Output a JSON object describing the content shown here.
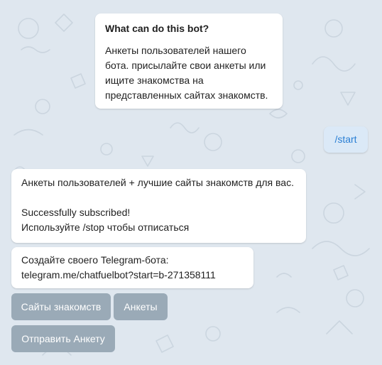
{
  "bot_info": {
    "title": "What can do this bot?",
    "description": "Анкеты пользователей нашего бота. присылайте свои анкеты или ищите знакомства на представленных сайтах знакомств."
  },
  "outgoing_message": {
    "text": "/start"
  },
  "messages": [
    {
      "lines": [
        "Анкеты пользователей + лучшие сайты знакомств для вас.",
        "",
        "Successfully subscribed!",
        "Используйте /stop чтобы отписаться"
      ]
    },
    {
      "lines": [
        "Создайте своего Telegram-бота:",
        "telegram.me/chatfuelbot?start=b-271358111"
      ]
    }
  ],
  "keyboard": {
    "row1": [
      "Сайты знакомств",
      "Анкеты"
    ],
    "row2": [
      "Отправить Анкету"
    ]
  },
  "colors": {
    "background": "#dfe7ef",
    "bubble": "#ffffff",
    "outgoing_text": "#2a7fd4",
    "keyboard_button": "#9aaab7"
  }
}
